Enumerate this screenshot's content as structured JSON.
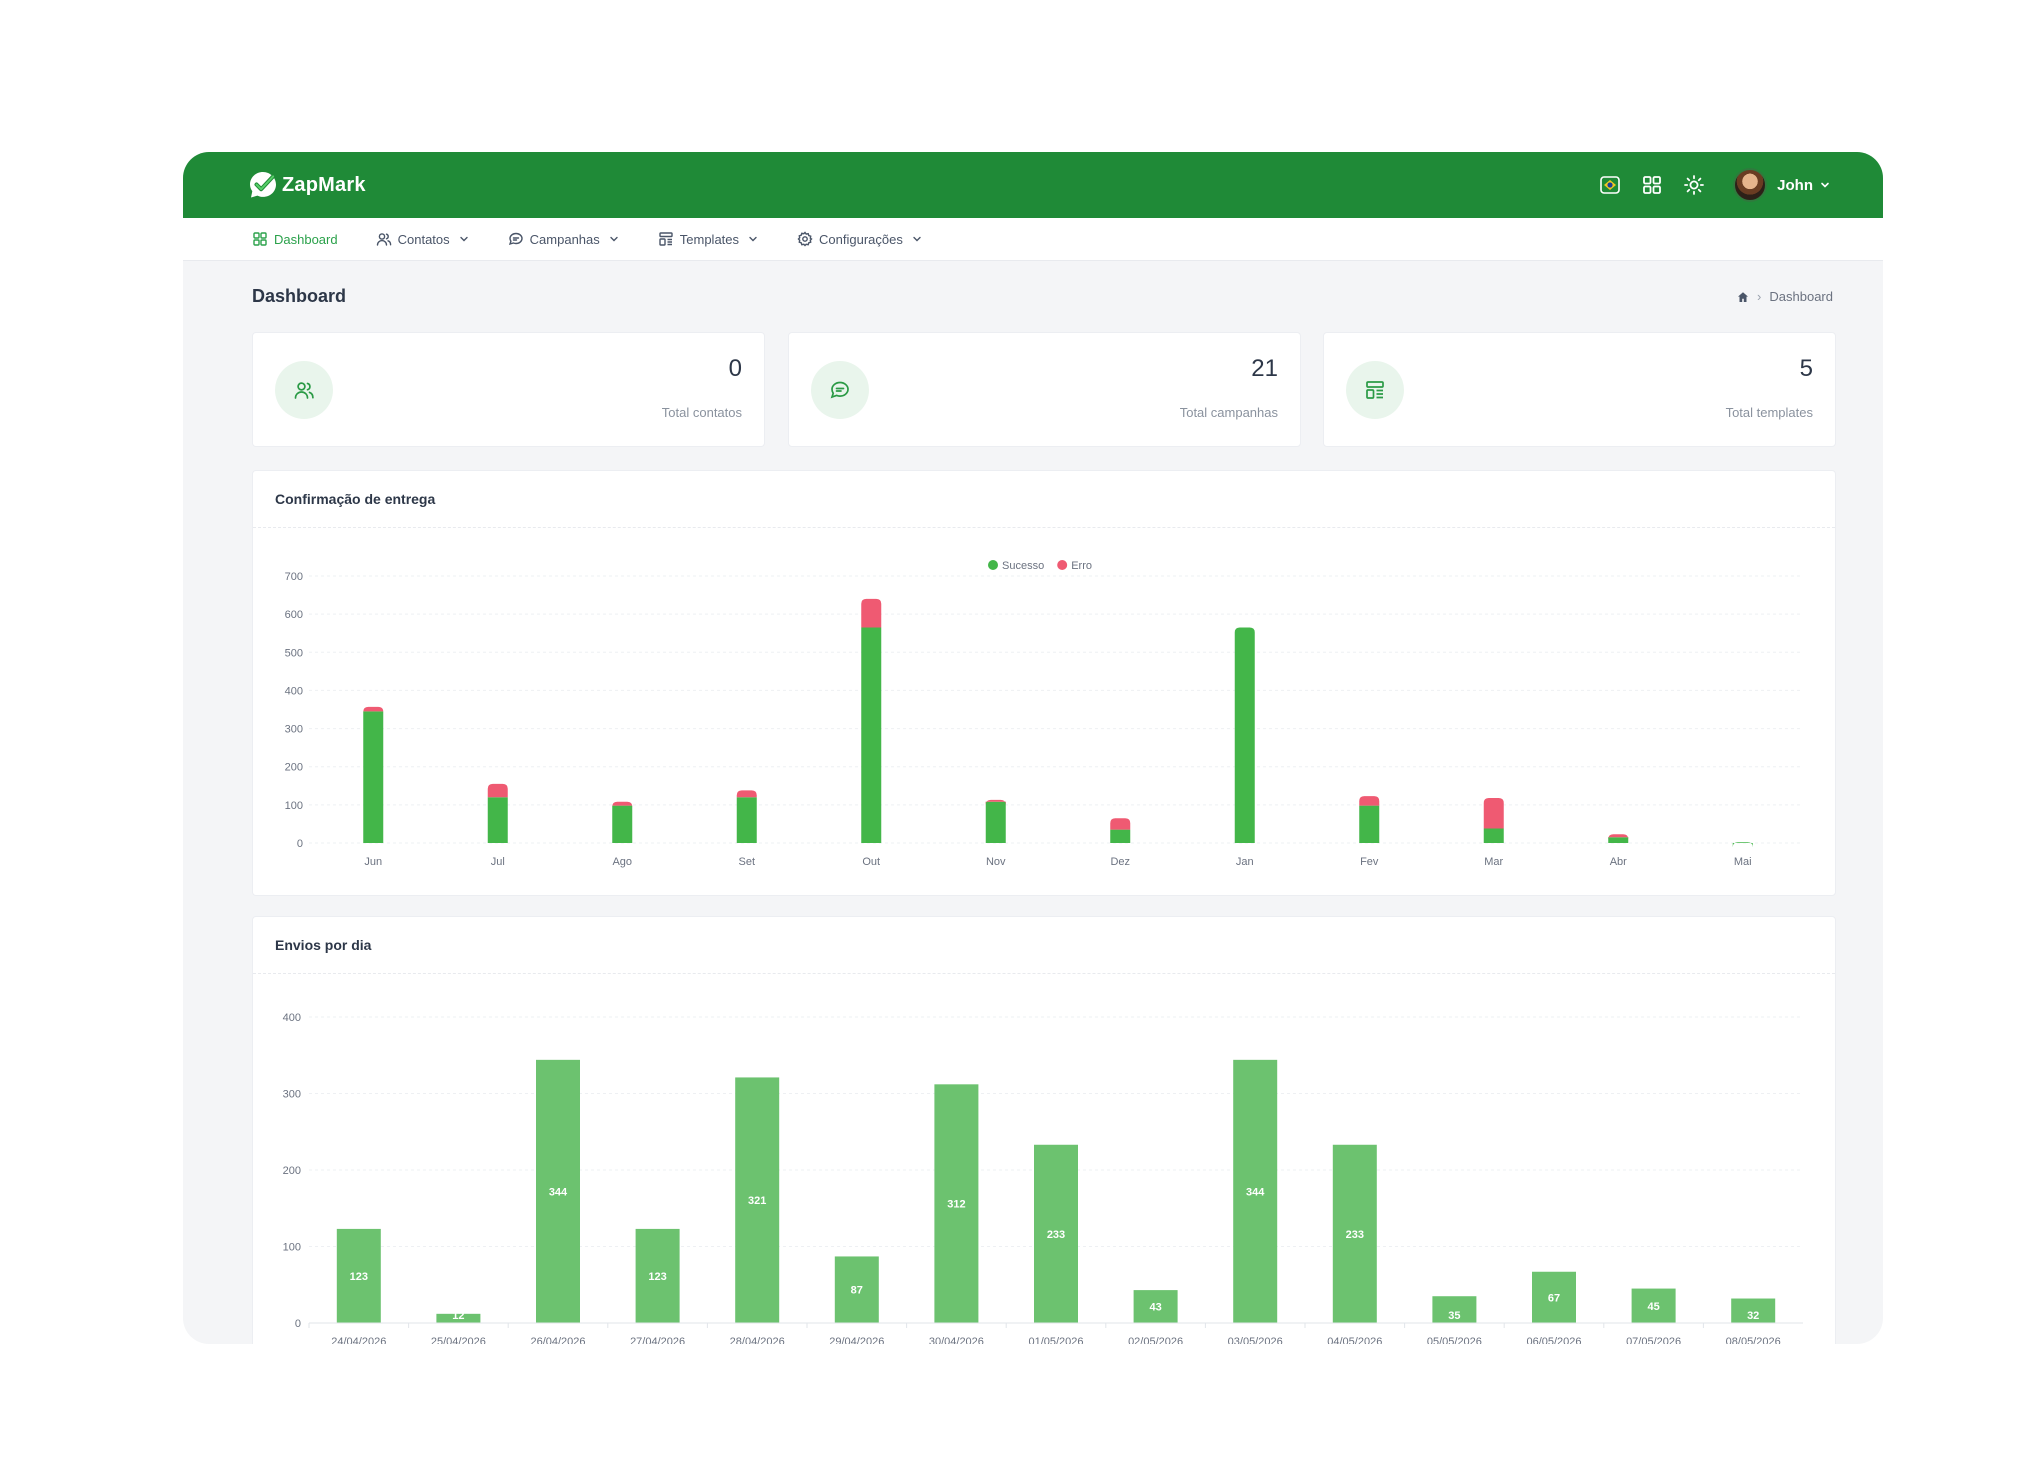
{
  "app": {
    "name": "ZapMark"
  },
  "user": {
    "name": "John"
  },
  "nav": {
    "items": [
      {
        "label": "Dashboard"
      },
      {
        "label": "Contatos"
      },
      {
        "label": "Campanhas"
      },
      {
        "label": "Templates"
      },
      {
        "label": "Configurações"
      }
    ]
  },
  "page": {
    "title": "Dashboard",
    "breadcrumb": "Dashboard"
  },
  "stats": [
    {
      "value": "0",
      "label": "Total contatos"
    },
    {
      "value": "21",
      "label": "Total campanhas"
    },
    {
      "value": "5",
      "label": "Total templates"
    }
  ],
  "colors": {
    "brand": "#1f8a37",
    "success": "#43b649",
    "error": "#ef5a72",
    "daily": "#6cc26f"
  },
  "chart_data": [
    {
      "type": "bar",
      "stacked": true,
      "title": "Confirmação de entrega",
      "categories": [
        "Jun",
        "Jul",
        "Ago",
        "Set",
        "Out",
        "Nov",
        "Dez",
        "Jan",
        "Fev",
        "Mar",
        "Abr",
        "Mai"
      ],
      "series": [
        {
          "name": "Sucesso",
          "color": "#43b649",
          "values": [
            345,
            120,
            98,
            120,
            565,
            108,
            35,
            565,
            98,
            38,
            15,
            2
          ]
        },
        {
          "name": "Erro",
          "color": "#ef5a72",
          "values": [
            12,
            35,
            10,
            18,
            75,
            5,
            30,
            0,
            25,
            80,
            8,
            0
          ]
        }
      ],
      "ylim": [
        0,
        700
      ],
      "yticks": [
        0,
        100,
        200,
        300,
        400,
        500,
        600,
        700
      ],
      "legend": "top-center",
      "grid": true
    },
    {
      "type": "bar",
      "title": "Envios por dia",
      "categories": [
        "24/04/2026",
        "25/04/2026",
        "26/04/2026",
        "27/04/2026",
        "28/04/2026",
        "29/04/2026",
        "30/04/2026",
        "01/05/2026",
        "02/05/2026",
        "03/05/2026",
        "04/05/2026",
        "05/05/2026",
        "06/05/2026",
        "07/05/2026",
        "08/05/2026"
      ],
      "values": [
        123,
        12,
        344,
        123,
        321,
        87,
        312,
        233,
        43,
        344,
        233,
        35,
        67,
        45,
        32
      ],
      "ylim": [
        0,
        400
      ],
      "yticks": [
        0,
        100,
        200,
        300,
        400
      ],
      "data_labels": true,
      "color": "#6cc26f",
      "grid": true
    }
  ]
}
